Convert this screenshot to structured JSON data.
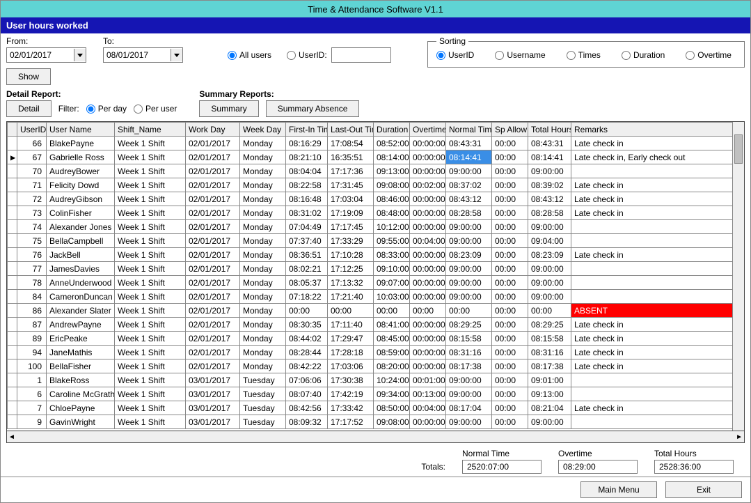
{
  "title": "Time & Attendance Software V1.1",
  "subtitle": "User hours worked",
  "labels": {
    "from": "From:",
    "to": "To:",
    "show": "Show",
    "allUsers": "All users",
    "userId": "UserID:",
    "sorting": "Sorting",
    "sortUser": "UserID",
    "sortUsername": "Username",
    "sortTimes": "Times",
    "sortDuration": "Duration",
    "sortOvertime": "Overtime",
    "detailReport": "Detail Report:",
    "detail": "Detail",
    "filter": "Filter:",
    "perDay": "Per day",
    "perUser": "Per user",
    "summaryReports": "Summary Reports:",
    "summary": "Summary",
    "summaryAbsence": "Summary Absence",
    "normalTime": "Normal Time",
    "overtime": "Overtime",
    "totalHours": "Total Hours",
    "totals": "Totals:",
    "mainMenu": "Main Menu",
    "exit": "Exit"
  },
  "fromDate": "02/01/2017",
  "toDate": "08/01/2017",
  "totals": {
    "normal": "2520:07:00",
    "overtime": "08:29:00",
    "total": "2528:36:00"
  },
  "columns": [
    "UserID",
    "User Name",
    "Shift_Name",
    "Work Day",
    "Week Day",
    "First-In Time",
    "Last-Out Time",
    "Duration",
    "Overtime",
    "Normal Time",
    "Sp Allow",
    "Total Hours",
    "Remarks"
  ],
  "rows": [
    {
      "m": "",
      "id": 66,
      "n": "BlakePayne",
      "s": "Week 1 Shift",
      "wd": "02/01/2017",
      "wk": "Monday",
      "fi": "08:16:29",
      "lo": "17:08:54",
      "d": "08:52:00",
      "o": "00:00:00",
      "nt": "08:43:31",
      "sp": "00:00",
      "th": "08:43:31",
      "r": "Late check in"
    },
    {
      "m": "▶",
      "id": 67,
      "n": "Gabrielle Ross",
      "s": "Week 1 Shift",
      "wd": "02/01/2017",
      "wk": "Monday",
      "fi": "08:21:10",
      "lo": "16:35:51",
      "d": "08:14:00",
      "o": "00:00:00",
      "nt": "08:14:41",
      "ntSel": true,
      "sp": "00:00",
      "th": "08:14:41",
      "r": "Late check in, Early check out"
    },
    {
      "m": "",
      "id": 70,
      "n": "AudreyBower",
      "s": "Week 1 Shift",
      "wd": "02/01/2017",
      "wk": "Monday",
      "fi": "08:04:04",
      "lo": "17:17:36",
      "d": "09:13:00",
      "o": "00:00:00",
      "nt": "09:00:00",
      "sp": "00:00",
      "th": "09:00:00",
      "r": ""
    },
    {
      "m": "",
      "id": 71,
      "n": "Felicity Dowd",
      "s": "Week 1 Shift",
      "wd": "02/01/2017",
      "wk": "Monday",
      "fi": "08:22:58",
      "lo": "17:31:45",
      "d": "09:08:00",
      "o": "00:02:00",
      "nt": "08:37:02",
      "sp": "00:00",
      "th": "08:39:02",
      "r": "Late check in"
    },
    {
      "m": "",
      "id": 72,
      "n": "AudreyGibson",
      "s": "Week 1 Shift",
      "wd": "02/01/2017",
      "wk": "Monday",
      "fi": "08:16:48",
      "lo": "17:03:04",
      "d": "08:46:00",
      "o": "00:00:00",
      "nt": "08:43:12",
      "sp": "00:00",
      "th": "08:43:12",
      "r": "Late check in"
    },
    {
      "m": "",
      "id": 73,
      "n": "ColinFisher",
      "s": "Week 1 Shift",
      "wd": "02/01/2017",
      "wk": "Monday",
      "fi": "08:31:02",
      "lo": "17:19:09",
      "d": "08:48:00",
      "o": "00:00:00",
      "nt": "08:28:58",
      "sp": "00:00",
      "th": "08:28:58",
      "r": "Late check in"
    },
    {
      "m": "",
      "id": 74,
      "n": "Alexander Jones",
      "s": "Week 1 Shift",
      "wd": "02/01/2017",
      "wk": "Monday",
      "fi": "07:04:49",
      "lo": "17:17:45",
      "d": "10:12:00",
      "o": "00:00:00",
      "nt": "09:00:00",
      "sp": "00:00",
      "th": "09:00:00",
      "r": ""
    },
    {
      "m": "",
      "id": 75,
      "n": "BellaCampbell",
      "s": "Week 1 Shift",
      "wd": "02/01/2017",
      "wk": "Monday",
      "fi": "07:37:40",
      "lo": "17:33:29",
      "d": "09:55:00",
      "o": "00:04:00",
      "nt": "09:00:00",
      "sp": "00:00",
      "th": "09:04:00",
      "r": ""
    },
    {
      "m": "",
      "id": 76,
      "n": "JackBell",
      "s": "Week 1 Shift",
      "wd": "02/01/2017",
      "wk": "Monday",
      "fi": "08:36:51",
      "lo": "17:10:28",
      "d": "08:33:00",
      "o": "00:00:00",
      "nt": "08:23:09",
      "sp": "00:00",
      "th": "08:23:09",
      "r": "Late check in"
    },
    {
      "m": "",
      "id": 77,
      "n": "JamesDavies",
      "s": "Week 1 Shift",
      "wd": "02/01/2017",
      "wk": "Monday",
      "fi": "08:02:21",
      "lo": "17:12:25",
      "d": "09:10:00",
      "o": "00:00:00",
      "nt": "09:00:00",
      "sp": "00:00",
      "th": "09:00:00",
      "r": ""
    },
    {
      "m": "",
      "id": 78,
      "n": "AnneUnderwood",
      "s": "Week 1 Shift",
      "wd": "02/01/2017",
      "wk": "Monday",
      "fi": "08:05:37",
      "lo": "17:13:32",
      "d": "09:07:00",
      "o": "00:00:00",
      "nt": "09:00:00",
      "sp": "00:00",
      "th": "09:00:00",
      "r": ""
    },
    {
      "m": "",
      "id": 84,
      "n": "CameronDuncan",
      "s": "Week 1 Shift",
      "wd": "02/01/2017",
      "wk": "Monday",
      "fi": "07:18:22",
      "lo": "17:21:40",
      "d": "10:03:00",
      "o": "00:00:00",
      "nt": "09:00:00",
      "sp": "00:00",
      "th": "09:00:00",
      "r": ""
    },
    {
      "m": "",
      "id": 86,
      "n": "Alexander Slater",
      "s": "Week 1 Shift",
      "wd": "02/01/2017",
      "wk": "Monday",
      "fi": "00:00",
      "lo": "00:00",
      "d": "00:00",
      "o": "00:00",
      "nt": "00:00",
      "sp": "00:00",
      "th": "00:00",
      "r": "ABSENT",
      "absent": true
    },
    {
      "m": "",
      "id": 87,
      "n": "AndrewPayne",
      "s": "Week 1 Shift",
      "wd": "02/01/2017",
      "wk": "Monday",
      "fi": "08:30:35",
      "lo": "17:11:40",
      "d": "08:41:00",
      "o": "00:00:00",
      "nt": "08:29:25",
      "sp": "00:00",
      "th": "08:29:25",
      "r": "Late check in"
    },
    {
      "m": "",
      "id": 89,
      "n": "EricPeake",
      "s": "Week 1 Shift",
      "wd": "02/01/2017",
      "wk": "Monday",
      "fi": "08:44:02",
      "lo": "17:29:47",
      "d": "08:45:00",
      "o": "00:00:00",
      "nt": "08:15:58",
      "sp": "00:00",
      "th": "08:15:58",
      "r": "Late check in"
    },
    {
      "m": "",
      "id": 94,
      "n": "JaneMathis",
      "s": "Week 1 Shift",
      "wd": "02/01/2017",
      "wk": "Monday",
      "fi": "08:28:44",
      "lo": "17:28:18",
      "d": "08:59:00",
      "o": "00:00:00",
      "nt": "08:31:16",
      "sp": "00:00",
      "th": "08:31:16",
      "r": "Late check in"
    },
    {
      "m": "",
      "id": 100,
      "n": "BellaFisher",
      "s": "Week 1 Shift",
      "wd": "02/01/2017",
      "wk": "Monday",
      "fi": "08:42:22",
      "lo": "17:03:06",
      "d": "08:20:00",
      "o": "00:00:00",
      "nt": "08:17:38",
      "sp": "00:00",
      "th": "08:17:38",
      "r": "Late check in"
    },
    {
      "m": "",
      "id": 1,
      "n": "BlakeRoss",
      "s": "Week 1 Shift",
      "wd": "03/01/2017",
      "wk": "Tuesday",
      "fi": "07:06:06",
      "lo": "17:30:38",
      "d": "10:24:00",
      "o": "00:01:00",
      "nt": "09:00:00",
      "sp": "00:00",
      "th": "09:01:00",
      "r": ""
    },
    {
      "m": "",
      "id": 6,
      "n": "Caroline McGrath",
      "s": "Week 1 Shift",
      "wd": "03/01/2017",
      "wk": "Tuesday",
      "fi": "08:07:40",
      "lo": "17:42:19",
      "d": "09:34:00",
      "o": "00:13:00",
      "nt": "09:00:00",
      "sp": "00:00",
      "th": "09:13:00",
      "r": ""
    },
    {
      "m": "",
      "id": 7,
      "n": "ChloePayne",
      "s": "Week 1 Shift",
      "wd": "03/01/2017",
      "wk": "Tuesday",
      "fi": "08:42:56",
      "lo": "17:33:42",
      "d": "08:50:00",
      "o": "00:04:00",
      "nt": "08:17:04",
      "sp": "00:00",
      "th": "08:21:04",
      "r": "Late check in"
    },
    {
      "m": "",
      "id": 9,
      "n": "GavinWright",
      "s": "Week 1 Shift",
      "wd": "03/01/2017",
      "wk": "Tuesday",
      "fi": "08:09:32",
      "lo": "17:17:52",
      "d": "09:08:00",
      "o": "00:00:00",
      "nt": "09:00:00",
      "sp": "00:00",
      "th": "09:00:00",
      "r": ""
    }
  ]
}
